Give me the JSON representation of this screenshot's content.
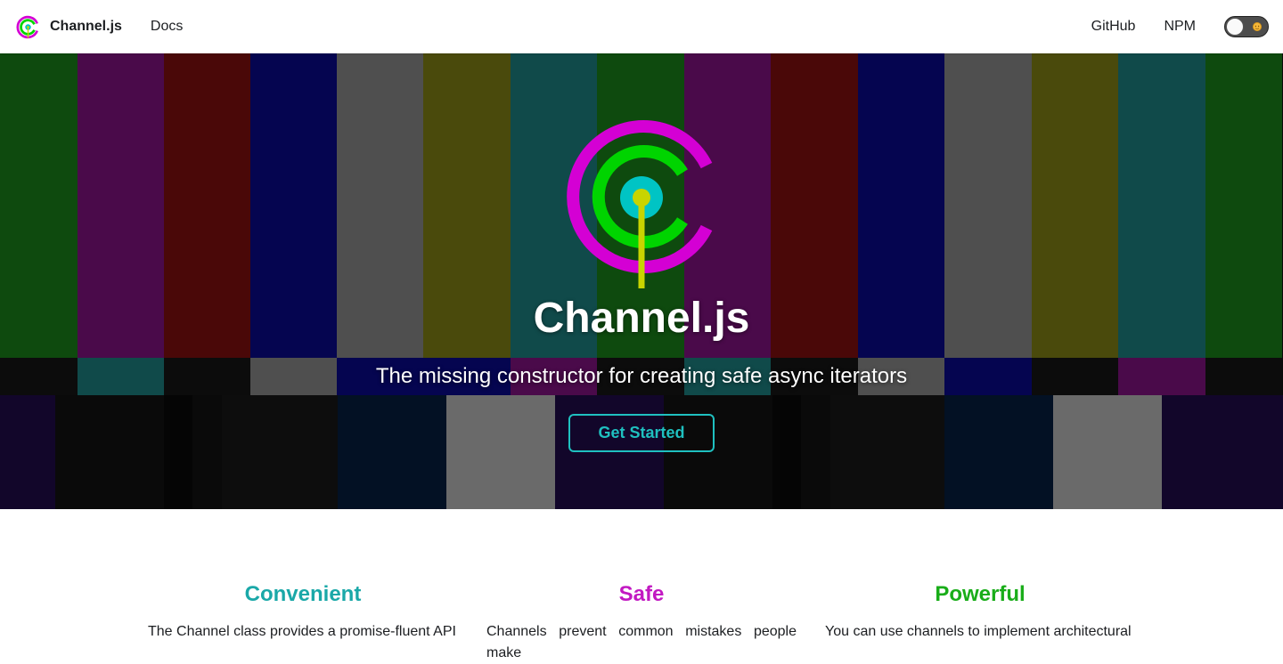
{
  "navbar": {
    "brand_title": "Channel.js",
    "links": {
      "docs": "Docs",
      "github": "GitHub",
      "npm": "NPM"
    },
    "theme_toggle": {
      "state": "light",
      "icon": "sun-icon"
    }
  },
  "hero": {
    "title": "Channel.js",
    "tagline": "The missing constructor for creating safe async iterators",
    "cta_label": "Get Started",
    "logo_icon": "channel-logo"
  },
  "features": [
    {
      "title": "Convenient",
      "color": "#1aa8a8",
      "text": "The Channel class provides a promise-fluent API"
    },
    {
      "title": "Safe",
      "color": "#c219c2",
      "text": "Channels prevent common mistakes people make"
    },
    {
      "title": "Powerful",
      "color": "#19ad19",
      "text": "You can use channels to implement architectural"
    }
  ],
  "colors": {
    "accent_cyan": "#1fc0c0",
    "logo_magenta": "#d400d4",
    "logo_green": "#00d400",
    "logo_cyan": "#00c4c4",
    "logo_yellow": "#c8d400"
  }
}
